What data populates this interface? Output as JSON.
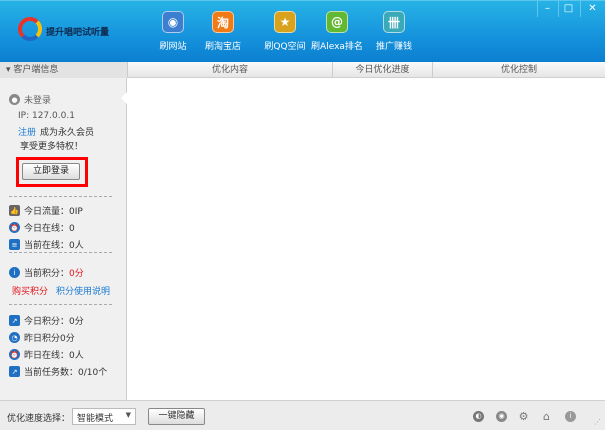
{
  "app": {
    "title": "提升唱吧试听量"
  },
  "nav": [
    {
      "label": "刷网站",
      "icon": "globe-icon",
      "color": "#3c7fd0"
    },
    {
      "label": "刷淘宝店",
      "icon": "taobao-icon",
      "color": "#f07a16"
    },
    {
      "label": "刷QQ空间",
      "icon": "star-icon",
      "color": "#d9a21c"
    },
    {
      "label": "刷Alexa排名",
      "icon": "at-icon",
      "color": "#63b833"
    },
    {
      "label": "推广赚钱",
      "icon": "promote-icon",
      "color": "#3aaab8"
    }
  ],
  "window": {
    "minimize": "–",
    "maximize": "□",
    "close": "✕"
  },
  "tabs": {
    "sidebar": "客户端信息",
    "content": "优化内容",
    "progress": "今日优化进度",
    "control": "优化控制"
  },
  "user": {
    "status": "未登录",
    "ip": "IP: 127.0.0.1",
    "register": "注册",
    "member": "成为永久会员",
    "privilege": "享受更多特权！",
    "login": "立即登录"
  },
  "stats1": [
    {
      "label": "今日流量：0IP"
    },
    {
      "label": "今日在线：0"
    },
    {
      "label": "当前在线：0人"
    }
  ],
  "points": {
    "label": "当前积分：",
    "value": "0分",
    "buy": "购买积分",
    "help": "积分使用说明"
  },
  "stats2": [
    {
      "label": "今日积分：0分"
    },
    {
      "label": "昨日积分0分"
    },
    {
      "label": "昨日在线：0人"
    },
    {
      "label": "当前任务数：0/10个"
    }
  ],
  "bottom": {
    "speed_label": "优化速度选择：",
    "speed_value": "智能模式",
    "hide": "一键隐藏"
  },
  "colors": {
    "accent": "#1592dc",
    "highlight": "#ff0000"
  }
}
